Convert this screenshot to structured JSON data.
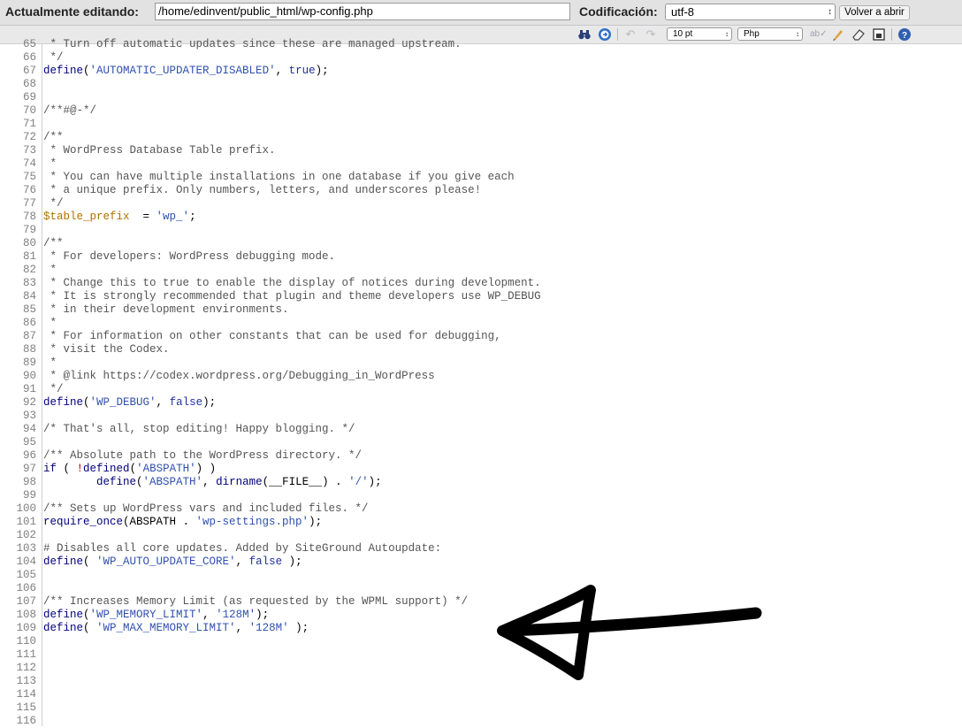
{
  "header": {
    "editing_label": "Actualmente editando:",
    "file_path": "/home/edinvent/public_html/wp-config.php",
    "encoding_label": "Codificación:",
    "encoding_value": "utf-8",
    "reopen_label": "Volver a abrir"
  },
  "toolbar": {
    "font_size": "10 pt",
    "syntax": "Php",
    "icons": [
      "binoculars-icon",
      "goto-icon",
      "undo-icon",
      "redo-icon",
      "spellcheck-icon",
      "highlight-icon",
      "eraser-icon",
      "fullscreen-icon",
      "help-icon"
    ]
  },
  "editor": {
    "lines": [
      {
        "n": "65",
        "code": " * Turn off automatic updates since these are managed upstream."
      },
      {
        "n": "66",
        "code": " */"
      },
      {
        "n": "67",
        "code": "define('AUTOMATIC_UPDATER_DISABLED', true);"
      },
      {
        "n": "68",
        "code": ""
      },
      {
        "n": "69",
        "code": ""
      },
      {
        "n": "70",
        "code": "/**#@-*/"
      },
      {
        "n": "71",
        "code": ""
      },
      {
        "n": "72",
        "code": "/**"
      },
      {
        "n": "73",
        "code": " * WordPress Database Table prefix."
      },
      {
        "n": "74",
        "code": " *"
      },
      {
        "n": "75",
        "code": " * You can have multiple installations in one database if you give each"
      },
      {
        "n": "76",
        "code": " * a unique prefix. Only numbers, letters, and underscores please!"
      },
      {
        "n": "77",
        "code": " */"
      },
      {
        "n": "78",
        "code": "$table_prefix  = 'wp_';"
      },
      {
        "n": "79",
        "code": ""
      },
      {
        "n": "80",
        "code": "/**"
      },
      {
        "n": "81",
        "code": " * For developers: WordPress debugging mode."
      },
      {
        "n": "82",
        "code": " *"
      },
      {
        "n": "83",
        "code": " * Change this to true to enable the display of notices during development."
      },
      {
        "n": "84",
        "code": " * It is strongly recommended that plugin and theme developers use WP_DEBUG"
      },
      {
        "n": "85",
        "code": " * in their development environments."
      },
      {
        "n": "86",
        "code": " *"
      },
      {
        "n": "87",
        "code": " * For information on other constants that can be used for debugging,"
      },
      {
        "n": "88",
        "code": " * visit the Codex."
      },
      {
        "n": "89",
        "code": " *"
      },
      {
        "n": "90",
        "code": " * @link https://codex.wordpress.org/Debugging_in_WordPress"
      },
      {
        "n": "91",
        "code": " */"
      },
      {
        "n": "92",
        "code": "define('WP_DEBUG', false);"
      },
      {
        "n": "93",
        "code": ""
      },
      {
        "n": "94",
        "code": "/* That's all, stop editing! Happy blogging. */"
      },
      {
        "n": "95",
        "code": ""
      },
      {
        "n": "96",
        "code": "/** Absolute path to the WordPress directory. */"
      },
      {
        "n": "97",
        "code": "if ( !defined('ABSPATH') )"
      },
      {
        "n": "98",
        "code": "        define('ABSPATH', dirname(__FILE__) . '/');"
      },
      {
        "n": "99",
        "code": ""
      },
      {
        "n": "100",
        "code": "/** Sets up WordPress vars and included files. */"
      },
      {
        "n": "101",
        "code": "require_once(ABSPATH . 'wp-settings.php');"
      },
      {
        "n": "102",
        "code": ""
      },
      {
        "n": "103",
        "code": "# Disables all core updates. Added by SiteGround Autoupdate:"
      },
      {
        "n": "104",
        "code": "define( 'WP_AUTO_UPDATE_CORE', false );"
      },
      {
        "n": "105",
        "code": ""
      },
      {
        "n": "106",
        "code": ""
      },
      {
        "n": "107",
        "code": "/** Increases Memory Limit (as requested by the WPML support) */"
      },
      {
        "n": "108",
        "code": "define('WP_MEMORY_LIMIT', '128M');"
      },
      {
        "n": "109",
        "code": "define( 'WP_MAX_MEMORY_LIMIT', '128M' );"
      },
      {
        "n": "110",
        "code": ""
      },
      {
        "n": "111",
        "code": ""
      },
      {
        "n": "112",
        "code": ""
      },
      {
        "n": "113",
        "code": ""
      },
      {
        "n": "114",
        "code": ""
      },
      {
        "n": "115",
        "code": ""
      },
      {
        "n": "116",
        "code": ""
      }
    ]
  },
  "annotation": {
    "arrow_color": "#000000"
  }
}
